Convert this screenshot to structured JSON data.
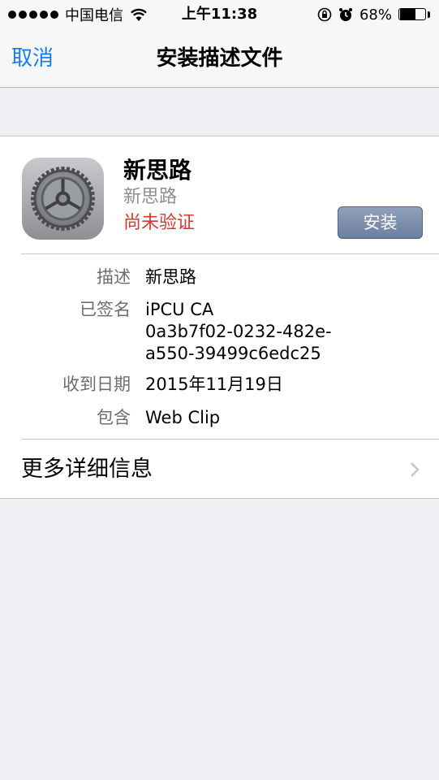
{
  "status_bar": {
    "carrier": "中国电信",
    "time": "上午11:38",
    "battery": "68%",
    "battery_level": 0.68,
    "icons": [
      "signal-dots-icon",
      "wifi-icon",
      "rotation-lock-icon",
      "alarm-icon",
      "battery-icon"
    ]
  },
  "nav": {
    "cancel_label": "取消",
    "title": "安装描述文件"
  },
  "profile": {
    "icon": "settings-gear-icon",
    "name": "新思路",
    "organization": "新思路",
    "verification_status": "尚未验证",
    "install_label": "安装"
  },
  "details": {
    "description_label": "描述",
    "description_value": "新思路",
    "signed_label": "已签名",
    "signed_lines": [
      "iPCU CA",
      "0a3b7f02-0232-482e-",
      "a550-39499c6edc25"
    ],
    "received_label": "收到日期",
    "received_value": "2015年11月19日",
    "contains_label": "包含",
    "contains_value": "Web Clip"
  },
  "more_info": {
    "label": "更多详细信息"
  },
  "colors": {
    "accent": "#1a7cf5",
    "unverified": "#d13a33",
    "background": "#efeff4",
    "install_button": "#7a8cab"
  }
}
